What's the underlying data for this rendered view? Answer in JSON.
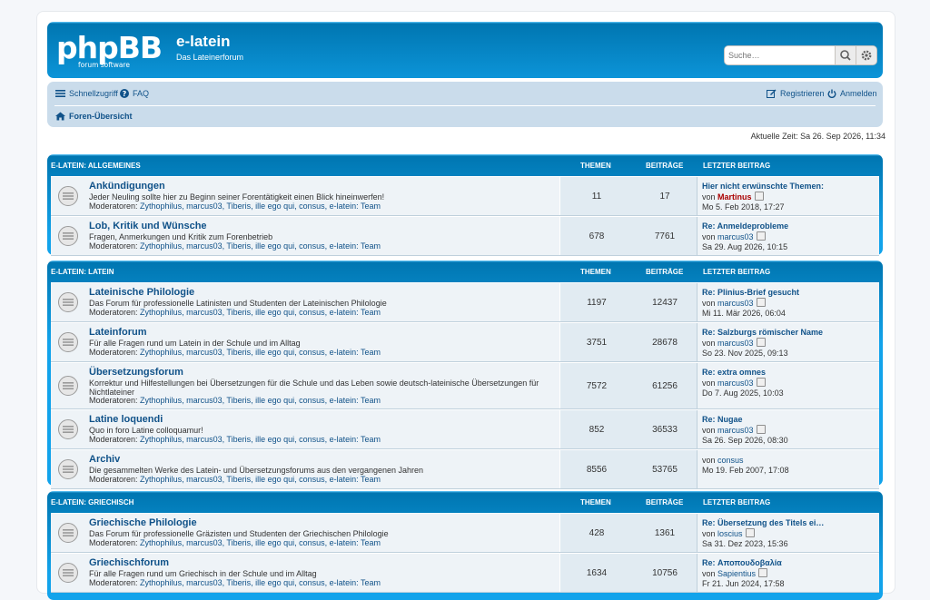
{
  "site": {
    "logo_text": "phpBB",
    "logo_sub": "forum software",
    "title": "e-latein",
    "description": "Das Lateinerforum"
  },
  "search": {
    "placeholder": "Suche…"
  },
  "nav": {
    "quicklinks": "Schnellzugriff",
    "faq": "FAQ",
    "register": "Registrieren",
    "login": "Anmelden",
    "breadcrumb": "Foren-Übersicht"
  },
  "current_time": "Aktuelle Zeit: Sa 26. Sep 2026, 11:34",
  "columns": {
    "topics": "THEMEN",
    "posts": "BEITRÄGE",
    "last": "LETZTER BEITRAG"
  },
  "moderators_label": "Moderatoren:",
  "moderators": "Zythophilus, marcus03, Tiberis, ille ego qui, consus, e-latein: Team",
  "categories": [
    {
      "name": "E-LATEIN: ALLGEMEINES",
      "forums": [
        {
          "title": "Ankündigungen",
          "desc": "Jeder Neuling sollte hier zu Beginn seiner Forentätigkeit einen Blick hineinwerfen!",
          "topics": "11",
          "posts": "17",
          "last_title": "Hier nicht erwünschte Themen:",
          "by": "von",
          "last_author": "Martinus",
          "last_date": "Mo 5. Feb 2018, 17:27"
        },
        {
          "title": "Lob, Kritik und Wünsche",
          "desc": "Fragen, Anmerkungen und Kritik zum Forenbetrieb",
          "topics": "678",
          "posts": "7761",
          "last_title": "Re: Anmeldeprobleme",
          "by": "von",
          "last_author": "marcus03",
          "last_date": "Sa 29. Aug 2026, 10:15"
        }
      ]
    },
    {
      "name": "E-LATEIN: LATEIN",
      "forums": [
        {
          "title": "Lateinische Philologie",
          "desc": "Das Forum für professionelle Latinisten und Studenten der Lateinischen Philologie",
          "topics": "1197",
          "posts": "12437",
          "last_title": "Re: Plinius-Brief gesucht",
          "by": "von",
          "last_author": "marcus03",
          "last_date": "Mi 11. Mär 2026, 06:04"
        },
        {
          "title": "Lateinforum",
          "desc": "Für alle Fragen rund um Latein in der Schule und im Alltag",
          "topics": "3751",
          "posts": "28678",
          "last_title": "Re: Salzburgs römischer Name",
          "by": "von",
          "last_author": "marcus03",
          "last_date": "So 23. Nov 2025, 09:13"
        },
        {
          "title": "Übersetzungsforum",
          "desc": "Korrektur und Hilfestellungen bei Übersetzungen für die Schule und das Leben sowie deutsch-lateinische Übersetzungen für Nichtlateiner",
          "topics": "7572",
          "posts": "61256",
          "last_title": "Re: extra omnes",
          "by": "von",
          "last_author": "marcus03",
          "last_date": "Do 7. Aug 2025, 10:03"
        },
        {
          "title": "Latine loquendi",
          "desc": "Quo in foro Latine colloquamur!",
          "topics": "852",
          "posts": "36533",
          "last_title": "Re: Nugae",
          "by": "von",
          "last_author": "marcus03",
          "last_date": "Sa 26. Sep 2026, 08:30"
        },
        {
          "title": "Archiv",
          "desc": "Die gesammelten Werke des Latein- und Übersetzungsforums aus den vergangenen Jahren",
          "topics": "8556",
          "posts": "53765",
          "last_title": "",
          "by": "von",
          "last_author": "consus",
          "last_date": "Mo 19. Feb 2007, 17:08"
        }
      ]
    },
    {
      "name": "E-LATEIN: GRIECHISCH",
      "forums": [
        {
          "title": "Griechische Philologie",
          "desc": "Das Forum für professionelle Gräzisten und Studenten der Griechischen Philologie",
          "topics": "428",
          "posts": "1361",
          "last_title": "Re: Übersetzung des Titels ei…",
          "by": "von",
          "last_author": "loscius",
          "last_date": "Sa 31. Dez 2023, 15:36"
        },
        {
          "title": "Griechischforum",
          "desc": "Für alle Fragen rund um Griechisch in der Schule und im Alltag",
          "topics": "1634",
          "posts": "10756",
          "last_title": "Re: Αποπουδοβαλία",
          "by": "von",
          "last_author": "Sapientius",
          "last_date": "Fr 21. Jun 2024, 17:58"
        }
      ]
    }
  ],
  "colors": {
    "accent": "#12a3eb",
    "link": "#105289",
    "row": "#eef3f7",
    "admin": "#aa0000"
  }
}
